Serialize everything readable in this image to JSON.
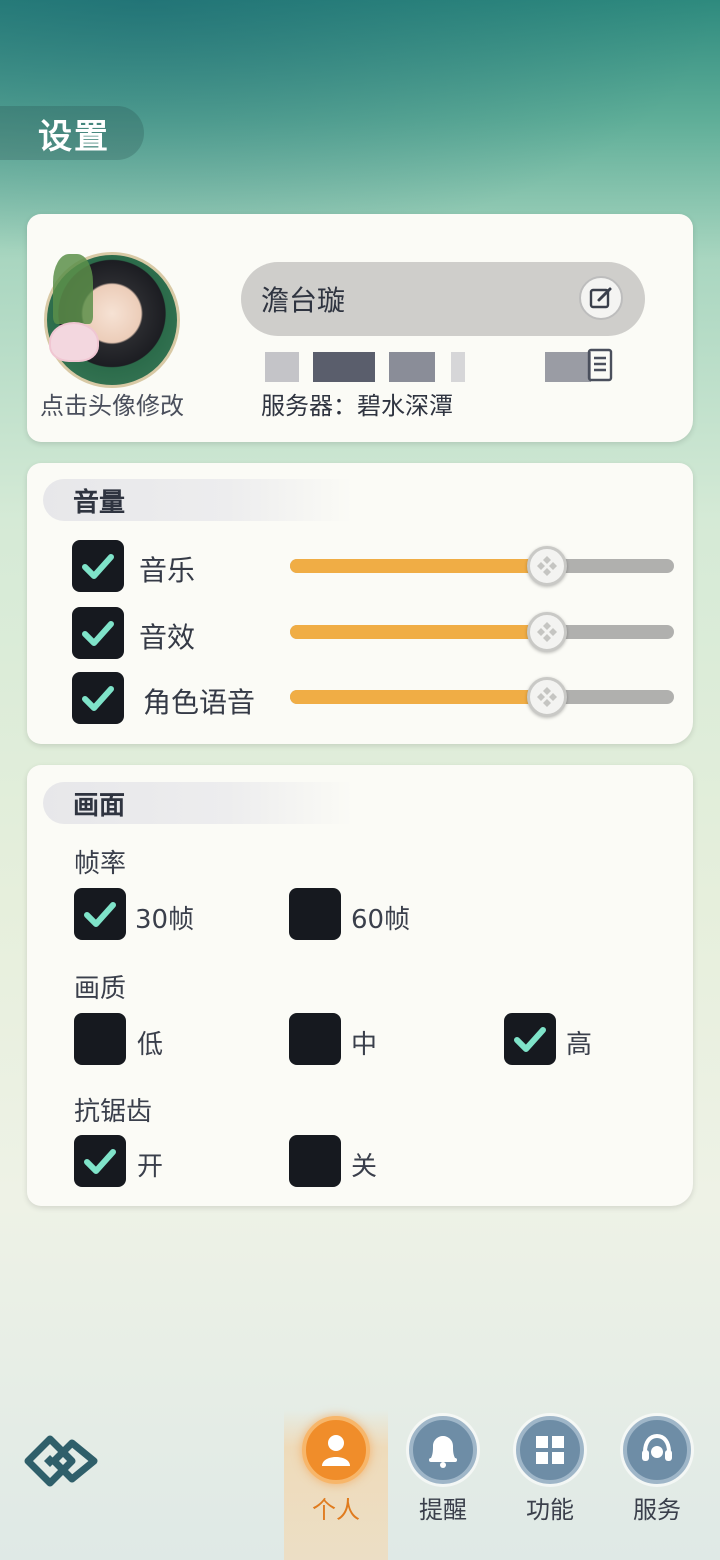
{
  "page": {
    "title": "设置"
  },
  "profile": {
    "avatar_caption": "点击头像修改",
    "nickname": "澹台璇",
    "server_label": "服务器：碧水深潭"
  },
  "volume": {
    "header": "音量",
    "items": [
      {
        "label": "音乐",
        "checked": true,
        "level": 0.67
      },
      {
        "label": "音效",
        "checked": true,
        "level": 0.67
      },
      {
        "label": "角色语音",
        "checked": true,
        "level": 0.67
      }
    ]
  },
  "display": {
    "header": "画面",
    "frame_rate": {
      "label": "帧率",
      "options": [
        {
          "label": "30帧",
          "checked": true
        },
        {
          "label": "60帧",
          "checked": false
        }
      ]
    },
    "quality": {
      "label": "画质",
      "options": [
        {
          "label": "低",
          "checked": false
        },
        {
          "label": "中",
          "checked": false
        },
        {
          "label": "高",
          "checked": true
        }
      ]
    },
    "antialias": {
      "label": "抗锯齿",
      "options": [
        {
          "label": "开",
          "checked": true
        },
        {
          "label": "关",
          "checked": false
        }
      ]
    }
  },
  "nav": {
    "items": [
      {
        "label": "个人",
        "active": true
      },
      {
        "label": "提醒",
        "active": false
      },
      {
        "label": "功能",
        "active": false
      },
      {
        "label": "服务",
        "active": false
      }
    ]
  },
  "colors": {
    "accent": "#f0ad45",
    "check_mark": "#7fe3c9",
    "active_nav": "#f08d2a"
  }
}
